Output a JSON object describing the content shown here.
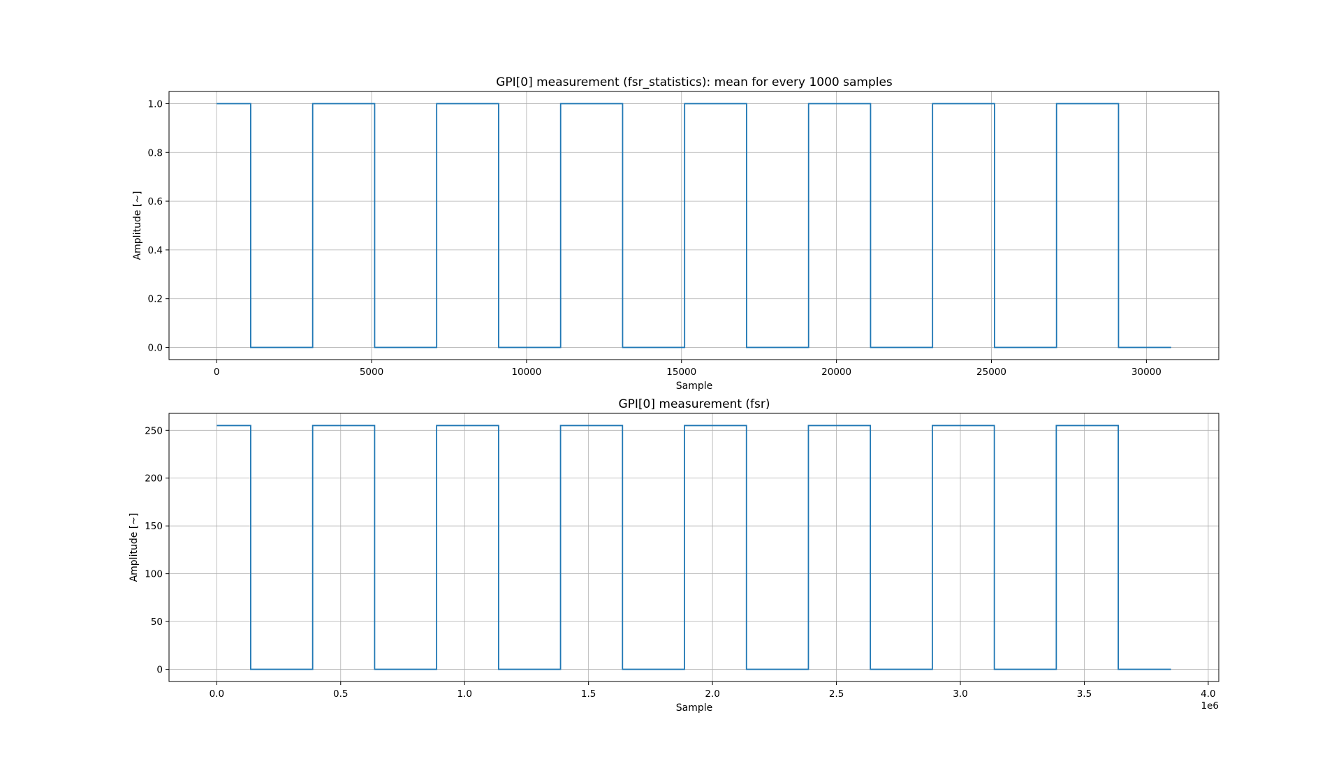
{
  "figure": {
    "background": "#ffffff",
    "line_color": "#1f77b4",
    "grid_color": "#b0b0b0"
  },
  "chart_data": [
    {
      "type": "line",
      "title": "GPI[0] measurement (fsr_statistics): mean for every 1000 samples",
      "xlabel": "Sample",
      "ylabel": "Amplitude [~]",
      "xlim": [
        -1535,
        32335
      ],
      "ylim": [
        -0.05,
        1.05
      ],
      "xticks": [
        0,
        5000,
        10000,
        15000,
        20000,
        25000,
        30000
      ],
      "xtick_labels": [
        "0",
        "5000",
        "10000",
        "15000",
        "20000",
        "25000",
        "30000"
      ],
      "yticks": [
        0.0,
        0.2,
        0.4,
        0.6,
        0.8,
        1.0
      ],
      "ytick_labels": [
        "0.0",
        "0.2",
        "0.4",
        "0.6",
        "0.8",
        "1.0"
      ],
      "offset_label": "",
      "grid": true,
      "drawstyle": "steps",
      "series": [
        {
          "x": [
            0,
            1100,
            1100,
            3100,
            3100,
            5100,
            5100,
            7100,
            7100,
            9100,
            9100,
            11100,
            11100,
            13100,
            13100,
            15100,
            15100,
            17100,
            17100,
            19100,
            19100,
            21100,
            21100,
            23100,
            23100,
            25100,
            25100,
            27100,
            27100,
            29100,
            29100,
            30800
          ],
          "y": [
            1,
            1,
            0,
            0,
            1,
            1,
            0,
            0,
            1,
            1,
            0,
            0,
            1,
            1,
            0,
            0,
            1,
            1,
            0,
            0,
            1,
            1,
            0,
            0,
            1,
            1,
            0,
            0,
            1,
            1,
            0,
            0
          ]
        }
      ]
    },
    {
      "type": "line",
      "title": "GPI[0] measurement (fsr)",
      "xlabel": "Sample",
      "ylabel": "Amplitude [~]",
      "xlim": [
        -192500,
        4042500
      ],
      "ylim": [
        -12.75,
        267.75
      ],
      "xticks": [
        0,
        500000,
        1000000,
        1500000,
        2000000,
        2500000,
        3000000,
        3500000,
        4000000
      ],
      "xtick_labels": [
        "0.0",
        "0.5",
        "1.0",
        "1.5",
        "2.0",
        "2.5",
        "3.0",
        "3.5",
        "4.0"
      ],
      "yticks": [
        0,
        50,
        100,
        150,
        200,
        250
      ],
      "ytick_labels": [
        "0",
        "50",
        "100",
        "150",
        "200",
        "250"
      ],
      "offset_label": "1e6",
      "grid": true,
      "drawstyle": "steps",
      "series": [
        {
          "x": [
            0,
            137000,
            137000,
            387000,
            387000,
            637000,
            637000,
            887000,
            887000,
            1137000,
            1137000,
            1387000,
            1387000,
            1637000,
            1637000,
            1887000,
            1887000,
            2137000,
            2137000,
            2387000,
            2387000,
            2637000,
            2637000,
            2887000,
            2887000,
            3137000,
            3137000,
            3387000,
            3387000,
            3637000,
            3637000,
            3850000
          ],
          "y": [
            255,
            255,
            0,
            0,
            255,
            255,
            0,
            0,
            255,
            255,
            0,
            0,
            255,
            255,
            0,
            0,
            255,
            255,
            0,
            0,
            255,
            255,
            0,
            0,
            255,
            255,
            0,
            0,
            255,
            255,
            0,
            0
          ]
        }
      ]
    }
  ]
}
